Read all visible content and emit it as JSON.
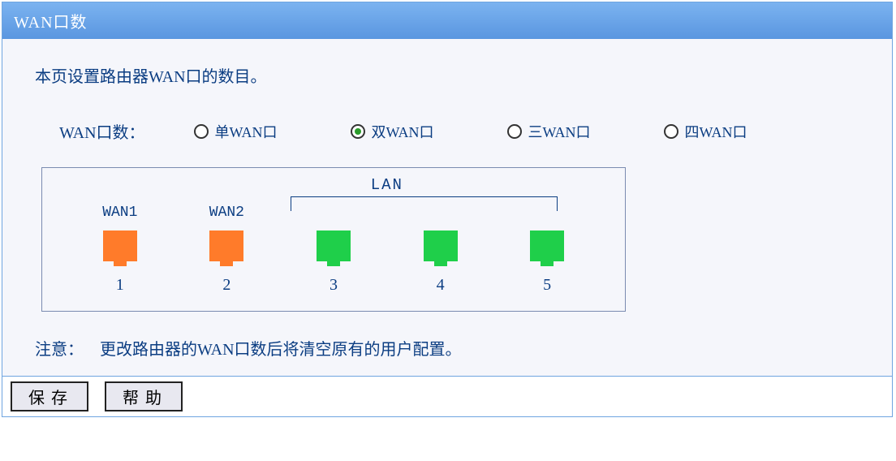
{
  "title": "WAN口数",
  "description": "本页设置路由器WAN口的数目。",
  "radioGroup": {
    "label": "WAN口数：",
    "options": [
      {
        "label": "单WAN口",
        "selected": false
      },
      {
        "label": "双WAN口",
        "selected": true
      },
      {
        "label": "三WAN口",
        "selected": false
      },
      {
        "label": "四WAN口",
        "selected": false
      }
    ]
  },
  "portsDiagram": {
    "lanGroupLabel": "LAN",
    "ports": [
      {
        "topLabel": "WAN1",
        "number": "1",
        "type": "wan"
      },
      {
        "topLabel": "WAN2",
        "number": "2",
        "type": "wan"
      },
      {
        "topLabel": "",
        "number": "3",
        "type": "lan"
      },
      {
        "topLabel": "",
        "number": "4",
        "type": "lan"
      },
      {
        "topLabel": "",
        "number": "5",
        "type": "lan"
      }
    ]
  },
  "note": {
    "prefix": "注意：",
    "text": "更改路由器的WAN口数后将清空原有的用户配置。"
  },
  "buttons": {
    "save": "保存",
    "help": "帮助"
  },
  "colors": {
    "wan": "#ff7b2a",
    "lan": "#1fcf4a",
    "headerBg": "#6aa3e8",
    "text": "#0b3d82"
  }
}
